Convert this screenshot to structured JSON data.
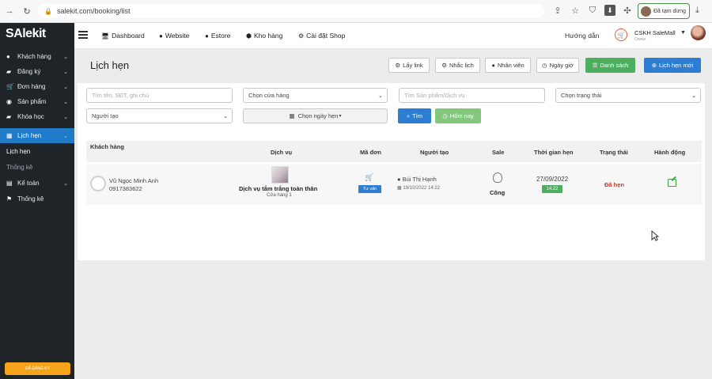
{
  "browser": {
    "url": "salekit.com/booking/list",
    "paused_label": "Đã tạm dừng"
  },
  "sidebar": {
    "logo": "SAlekit",
    "items": [
      {
        "label": "Khách hàng",
        "icon": "user-icon"
      },
      {
        "label": "Đăng ký",
        "icon": "book-icon"
      },
      {
        "label": "Đơn hàng",
        "icon": "cart-icon"
      },
      {
        "label": "Sản phẩm",
        "icon": "product-icon"
      },
      {
        "label": "Khóa học",
        "icon": "book-icon"
      },
      {
        "label": "Lịch hẹn",
        "icon": "calendar-icon"
      },
      {
        "label": "Kế toán",
        "icon": "calculator-icon"
      },
      {
        "label": "Thống kê",
        "icon": "flag-icon"
      }
    ],
    "subitems": [
      {
        "label": "Lịch hẹn"
      },
      {
        "label": "Thống kê"
      }
    ],
    "active_color": "#1f7ac8",
    "bottom_label": "ĐÃ ĐĂNG KÝ"
  },
  "topnav": {
    "items": [
      {
        "label": "Dashboard",
        "icon": "monitor-icon"
      },
      {
        "label": "Website",
        "icon": "globe-icon"
      },
      {
        "label": "Estore",
        "icon": "globe-icon"
      },
      {
        "label": "Kho hàng",
        "icon": "cubes-icon"
      },
      {
        "label": "Cài đặt Shop",
        "icon": "gear-icon"
      }
    ],
    "guide": "Hướng dẫn",
    "account_name": "CSKH SaleMall",
    "account_role": "Owner"
  },
  "page": {
    "title": "Lịch hẹn",
    "toolbar": [
      {
        "label": "Lấy link",
        "icon": "gear-icon"
      },
      {
        "label": "Nhắc lịch",
        "icon": "gear-icon"
      },
      {
        "label": "Nhân viên",
        "icon": "user-icon"
      },
      {
        "label": "Ngày giờ",
        "icon": "clock-icon"
      },
      {
        "label": "Danh sách",
        "icon": "list-icon"
      },
      {
        "label": "Lịch hẹn mới",
        "icon": "plus-circle-icon"
      }
    ]
  },
  "filters": {
    "search_placeholder": "Tìm tên, SĐT, ghi chú",
    "store_select": "Chọn cửa hàng",
    "product_placeholder": "Tìm Sản phẩm/Dịch vụ",
    "status_select": "Chọn trạng thái",
    "creator_select": "Người tạo",
    "date_select": "Chọn ngày hẹn",
    "search_button": "Tìm",
    "today_button": "Hôm nay"
  },
  "table": {
    "headers": [
      "Khách hàng",
      "Dịch vụ",
      "Mã đơn",
      "Người tạo",
      "Sale",
      "Thời gian hẹn",
      "Trạng thái",
      "Hành động"
    ],
    "rows": [
      {
        "customer_name": "Vũ Ngọc Minh Anh",
        "customer_phone": "0917383622",
        "service_name": "Dịch vụ tắm trắng toàn thân",
        "service_store": "Cửa hàng 1",
        "order_badge": "Tư vấn",
        "creator_name": "Bùi Thị Hạnh",
        "created_at": "19/10/2022 14:22",
        "sale_status": "Công",
        "appointment_date": "27/09/2022",
        "appointment_time": "14:22",
        "status": "Đã hẹn"
      }
    ]
  }
}
